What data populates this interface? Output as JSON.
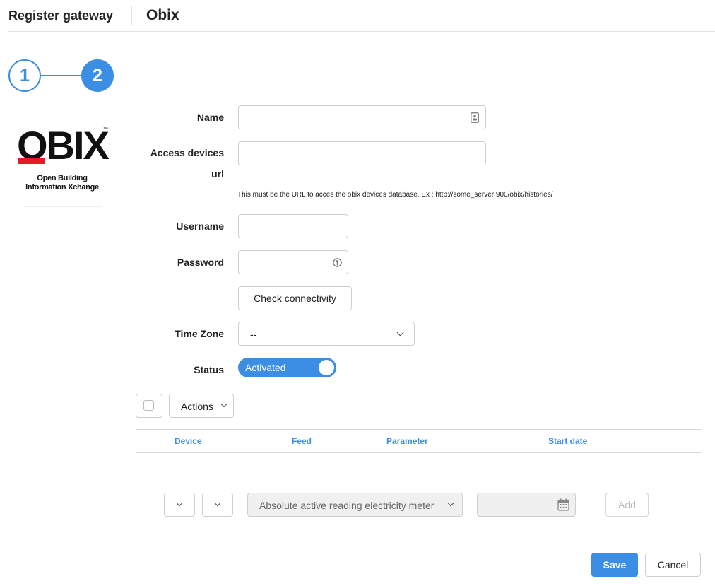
{
  "header": {
    "title": "Register gateway",
    "subtitle": "Obix"
  },
  "stepper": {
    "steps": [
      "1",
      "2"
    ],
    "current_step": 2
  },
  "logo": {
    "word": "OBIX",
    "trademark": "™",
    "tagline_line1": "Open Building",
    "tagline_line2": "Information Xchange",
    "accent_color": "#e41b23"
  },
  "form": {
    "name": {
      "label": "Name",
      "value": ""
    },
    "access_url": {
      "label_line1": "Access devices",
      "label_line2": "url",
      "value": "",
      "hint": "This must be the URL to acces the obix devices database. Ex : http://some_server:900/obix/histories/"
    },
    "username": {
      "label": "Username",
      "value": ""
    },
    "password": {
      "label": "Password",
      "value": ""
    },
    "check_connectivity_label": "Check connectivity",
    "time_zone": {
      "label": "Time Zone",
      "value": "--"
    },
    "status": {
      "label": "Status",
      "value": "Activated",
      "on": true
    }
  },
  "feeds": {
    "actions_label": "Actions",
    "columns": [
      "Device",
      "Feed",
      "Parameter",
      "Start date"
    ],
    "rows": [],
    "new_row": {
      "device": "",
      "feed": "",
      "parameter": "Absolute active reading electricity meter",
      "start_date": "",
      "add_label": "Add"
    }
  },
  "footer": {
    "save_label": "Save",
    "cancel_label": "Cancel"
  },
  "colors": {
    "accent": "#3b8ee3",
    "border": "#cfcfcf"
  }
}
